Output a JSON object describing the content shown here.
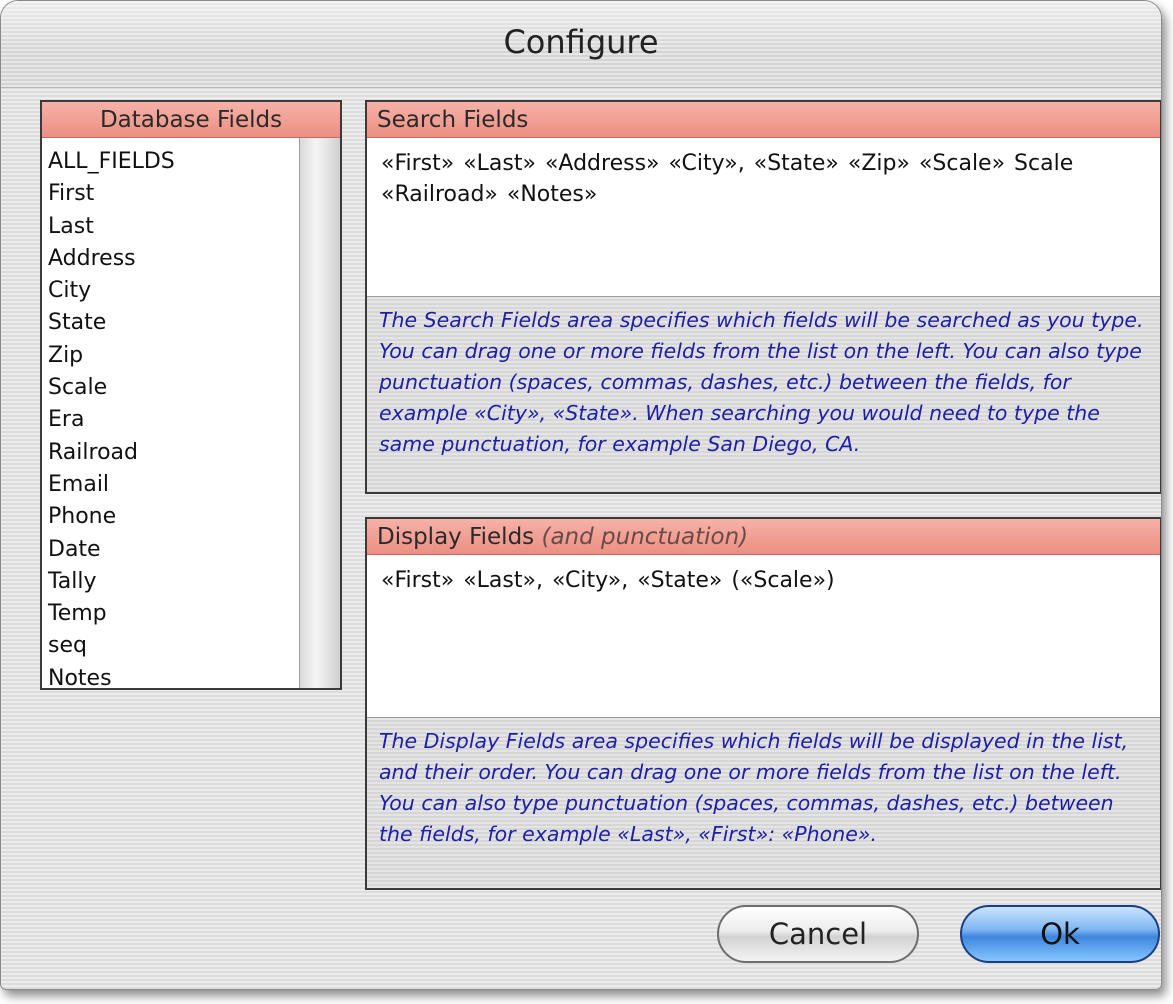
{
  "window": {
    "title": "Configure"
  },
  "database_fields": {
    "header": "Database Fields",
    "items": [
      "ALL_FIELDS",
      "First",
      "Last",
      "Address",
      "City",
      "State",
      "Zip",
      "Scale",
      "Era",
      "Railroad",
      "Email",
      "Phone",
      "Date",
      "Tally",
      "Temp",
      "seq",
      "Notes"
    ]
  },
  "search_fields": {
    "header": "Search Fields",
    "value": "«First» «Last» «Address» «City», «State» «Zip» «Scale» Scale «Railroad» «Notes»",
    "help": "The Search Fields area specifies which fields will be searched as you type. You can drag one or more fields from the list on the left. You can also type punctuation (spaces, commas, dashes, etc.) between the fields, for example «City», «State». When searching you would need to type the same punctuation, for example San Diego, CA."
  },
  "display_fields": {
    "header": "Display Fields",
    "header_note": "(and punctuation)",
    "value": "«First» «Last», «City», «State» («Scale»)",
    "help": "The Display Fields area specifies which fields will be displayed in the list, and their order. You can drag one or more fields from the list on the left. You can also type punctuation (spaces, commas, dashes, etc.) between the fields, for example «Last», «First»: «Phone»."
  },
  "buttons": {
    "cancel": "Cancel",
    "ok": "Ok"
  },
  "colors": {
    "header_accent": "#ec8f82",
    "help_text": "#1e1ea8",
    "default_button": "#3d86dd"
  }
}
